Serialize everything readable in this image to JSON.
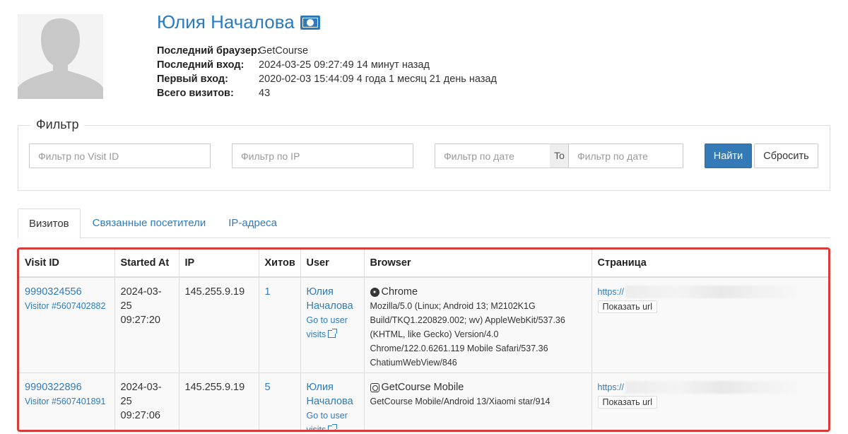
{
  "profile": {
    "name": "Юлия Началова",
    "avatar_icon": "user-silhouette-icon",
    "badge_icon": "money-icon",
    "info": [
      {
        "label": "Последний браузер:",
        "value": "GetCourse"
      },
      {
        "label": "Последний вход:",
        "value": "2024-03-25 09:27:49 14 минут назад"
      },
      {
        "label": "Первый вход:",
        "value": "2020-02-03 15:44:09 4 года 1 месяц 21 день назад"
      },
      {
        "label": "Всего визитов:",
        "value": "43"
      }
    ]
  },
  "filter": {
    "legend": "Фильтр",
    "visit_id_placeholder": "Фильтр по Visit ID",
    "ip_placeholder": "Фильтр по IP",
    "date_from_placeholder": "Фильтр по дате",
    "to_label": "To",
    "date_to_placeholder": "Фильтр по дате",
    "search_label": "Найти",
    "reset_label": "Сбросить"
  },
  "tabs": [
    {
      "label": "Визитов",
      "active": true
    },
    {
      "label": "Связанные посетители",
      "active": false
    },
    {
      "label": "IP-адреса",
      "active": false
    }
  ],
  "table": {
    "headers": [
      "Visit ID",
      "Started At",
      "IP",
      "Хитов",
      "User",
      "Browser",
      "Страница"
    ],
    "rows": [
      {
        "visit_id": "9990324556",
        "visitor": "Visitor #5607402882",
        "started_at": "2024-03-25 09:27:20",
        "ip": "145.255.9.19",
        "hits": "1",
        "user_name": "Юлия Началова",
        "user_link": "Go to user visits",
        "browser_icon": "chrome-icon",
        "browser_name": "Chrome",
        "user_agent": "Mozilla/5.0 (Linux; Android 13; M2102K1G Build/TKQ1.220829.002; wv) AppleWebKit/537.36 (KHTML, like Gecko) Version/4.0 Chrome/122.0.6261.119 Mobile Safari/537.36 ChatiumWebView/846",
        "page_url_prefix": "https://",
        "show_url_label": "Показать url"
      },
      {
        "visit_id": "9990322896",
        "visitor": "Visitor #5607401891",
        "started_at": "2024-03-25 09:27:06",
        "ip": "145.255.9.19",
        "hits": "5",
        "user_name": "Юлия Началова",
        "user_link": "Go to user visits",
        "browser_icon": "app-icon",
        "browser_name": "GetCourse Mobile",
        "user_agent": "GetCourse Mobile/Android 13/Xiaomi star/914",
        "page_url_prefix": "https://",
        "show_url_label": "Показать url"
      }
    ]
  },
  "colors": {
    "link": "#2d7bbd",
    "primary_button": "#337ab7",
    "highlight_border": "#d93a3a"
  }
}
